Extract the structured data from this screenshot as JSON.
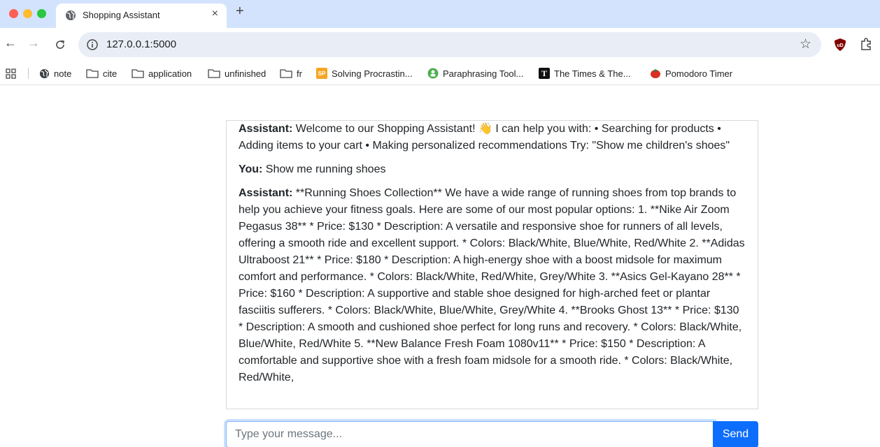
{
  "browser": {
    "tab": {
      "title": "Shopping Assistant",
      "close": "×"
    },
    "new_tab": "+",
    "url": "127.0.0.1:5000",
    "bookmarks": [
      {
        "label": "note",
        "icon": "globe-icon"
      },
      {
        "label": "cite",
        "icon": "folder-icon"
      },
      {
        "label": "application",
        "icon": "folder-icon"
      },
      {
        "label": "unfinished",
        "icon": "folder-icon"
      },
      {
        "label": "fr",
        "icon": "folder-icon"
      },
      {
        "label": "Solving Procrastin...",
        "icon": "sp-icon"
      },
      {
        "label": "Paraphrasing Tool...",
        "icon": "paraphrase-icon"
      },
      {
        "label": "The Times & The...",
        "icon": "times-icon"
      },
      {
        "label": "Pomodoro Timer",
        "icon": "tomato-icon"
      }
    ]
  },
  "chat": {
    "messages": [
      {
        "sender": "Assistant:",
        "text": " Welcome to our Shopping Assistant! 👋 I can help you with: • Searching for products • Adding items to your cart • Making personalized recommendations Try: \"Show me children's shoes\""
      },
      {
        "sender": "You:",
        "text": " Show me running shoes"
      },
      {
        "sender": "Assistant:",
        "text": " **Running Shoes Collection** We have a wide range of running shoes from top brands to help you achieve your fitness goals. Here are some of our most popular options: 1. **Nike Air Zoom Pegasus 38** * Price: $130 * Description: A versatile and responsive shoe for runners of all levels, offering a smooth ride and excellent support. * Colors: Black/White, Blue/White, Red/White 2. **Adidas Ultraboost 21** * Price: $180 * Description: A high-energy shoe with a boost midsole for maximum comfort and performance. * Colors: Black/White, Red/White, Grey/White 3. **Asics Gel-Kayano 28** * Price: $160 * Description: A supportive and stable shoe designed for high-arched feet or plantar fasciitis sufferers. * Colors: Black/White, Blue/White, Grey/White 4. **Brooks Ghost 13** * Price: $130 * Description: A smooth and cushioned shoe perfect for long runs and recovery. * Colors: Black/White, Blue/White, Red/White 5. **New Balance Fresh Foam 1080v11** * Price: $150 * Description: A comfortable and supportive shoe with a fresh foam midsole for a smooth ride. * Colors: Black/White, Red/White,"
      }
    ],
    "input_placeholder": "Type your message...",
    "send_label": "Send"
  },
  "colors": {
    "tabstrip": "#d3e3fd",
    "accent": "#0d6efd"
  }
}
